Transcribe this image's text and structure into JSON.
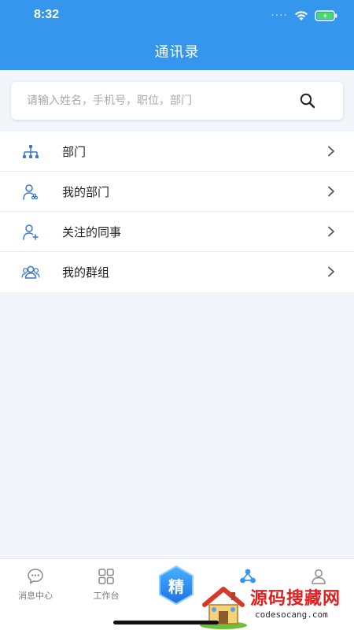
{
  "status_bar": {
    "time": "8:32",
    "signal": "····"
  },
  "header": {
    "title": "通讯录",
    "background_color": "#3596ee"
  },
  "search": {
    "placeholder": "请输入姓名，手机号，职位，部门",
    "value": "",
    "icon": "search-icon"
  },
  "menu": {
    "items": [
      {
        "label": "部门",
        "icon": "org-chart-icon"
      },
      {
        "label": "我的部门",
        "icon": "user-group-icon"
      },
      {
        "label": "关注的同事",
        "icon": "user-add-icon"
      },
      {
        "label": "我的群组",
        "icon": "group-icon"
      }
    ]
  },
  "tabbar": {
    "items": [
      {
        "label": "消息中心",
        "icon": "chat-icon"
      },
      {
        "label": "工作台",
        "icon": "grid-icon"
      },
      {
        "label": "精",
        "icon": "hexagon-icon"
      },
      {
        "label": "",
        "icon": "contacts-icon"
      },
      {
        "label": "",
        "icon": "user-icon"
      }
    ],
    "active_color": "#3596ee"
  },
  "watermark": {
    "title": "源码搜藏网",
    "url": "codesocang.com"
  }
}
